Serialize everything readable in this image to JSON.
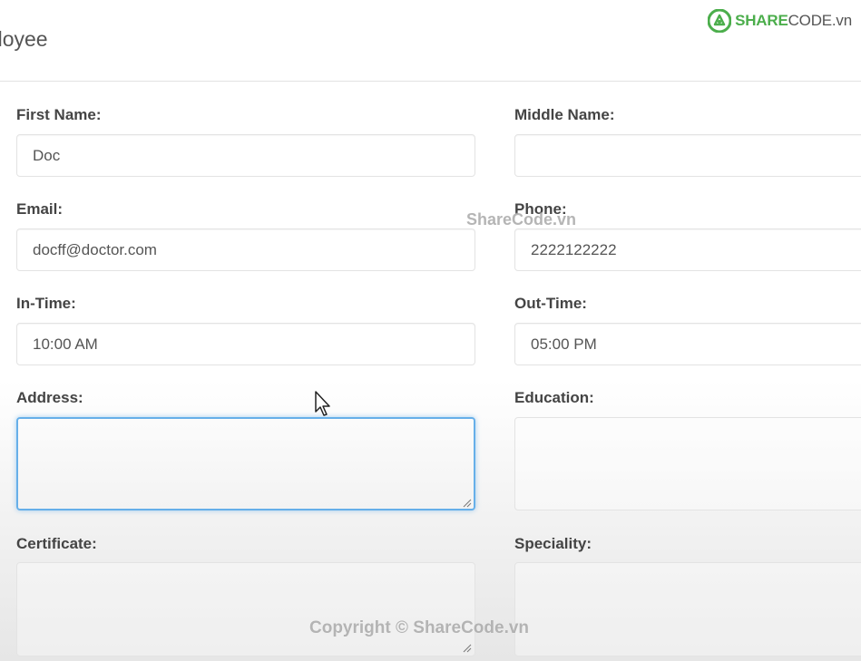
{
  "page": {
    "title": "nployee"
  },
  "brand": {
    "name_bold": "SHARE",
    "name_rest": "CODE.vn",
    "accent_color": "#4cae4c"
  },
  "form": {
    "first_name": {
      "label": "First Name:",
      "value": "Doc"
    },
    "middle_name": {
      "label": "Middle Name:",
      "value": ""
    },
    "email": {
      "label": "Email:",
      "value": "docff@doctor.com"
    },
    "phone": {
      "label": "Phone:",
      "value": "2222122222"
    },
    "in_time": {
      "label": "In-Time:",
      "value": "10:00 AM"
    },
    "out_time": {
      "label": "Out-Time:",
      "value": "05:00 PM"
    },
    "address": {
      "label": "Address:",
      "value": ""
    },
    "education": {
      "label": "Education:",
      "value": ""
    },
    "certificate": {
      "label": "Certificate:",
      "value": ""
    },
    "speciality": {
      "label": "Speciality:",
      "value": ""
    }
  },
  "watermarks": {
    "center": "ShareCode.vn",
    "footer": "Copyright © ShareCode.vn"
  },
  "icons": {
    "brand": "sharecode-logo-icon",
    "cursor": "mouse-pointer-icon",
    "resize": "resize-grip-icon"
  }
}
